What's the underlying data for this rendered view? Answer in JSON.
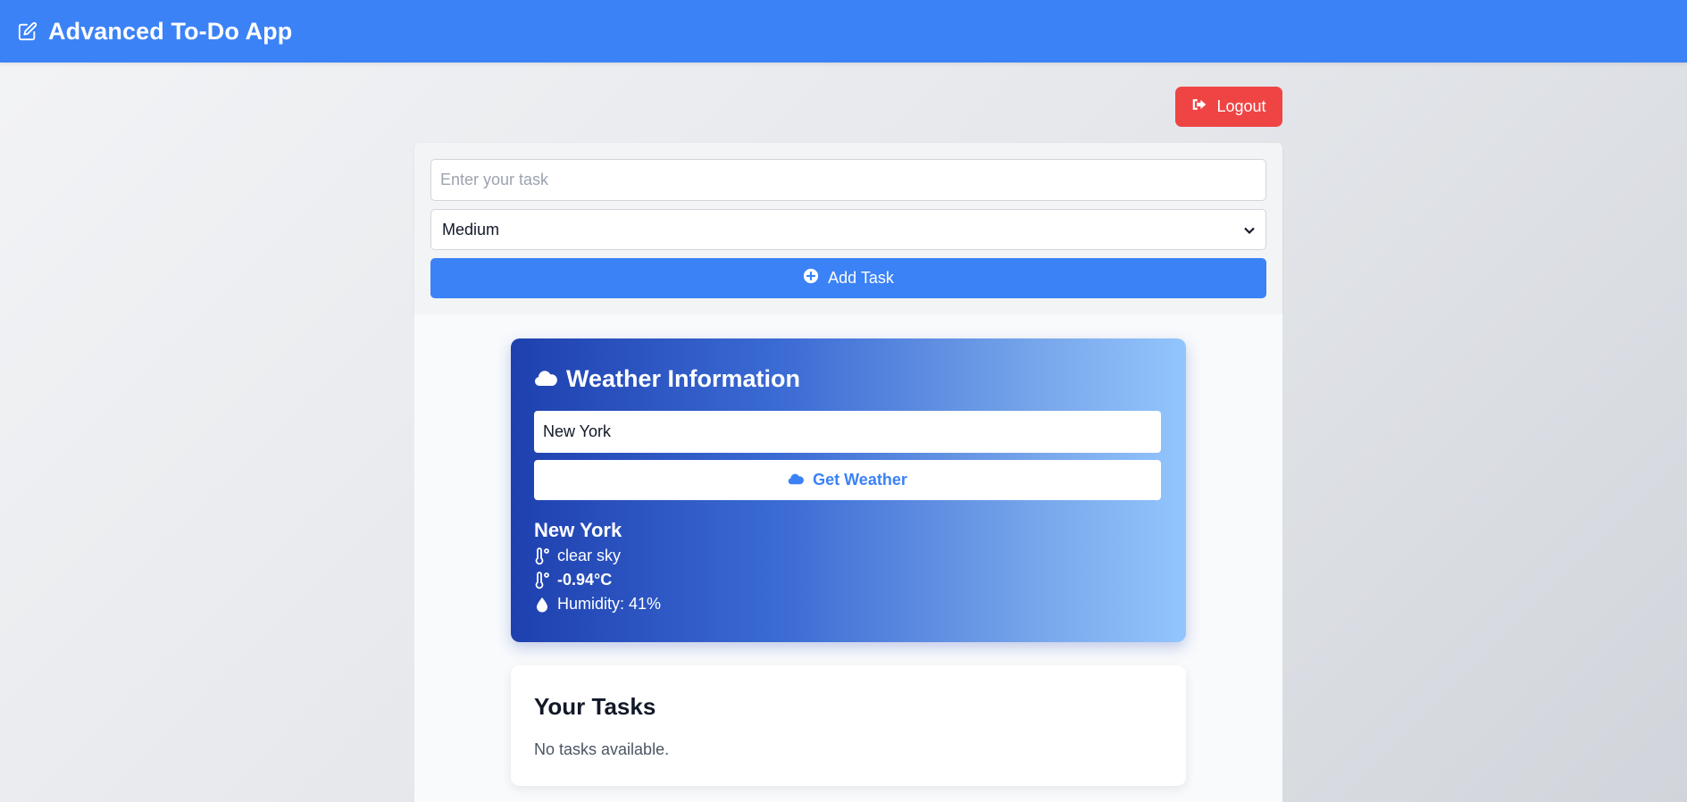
{
  "navbar": {
    "title": "Advanced To-Do App",
    "icon": "edit-icon",
    "bg_color": "#3b82f6"
  },
  "logout": {
    "label": "Logout",
    "icon": "sign-out-icon",
    "color": "#ef4444"
  },
  "task_form": {
    "input_placeholder": "Enter your task",
    "input_value": "",
    "priority_selected": "Medium",
    "add_label": "Add Task",
    "add_icon": "plus-circle-icon"
  },
  "weather": {
    "title": "Weather Information",
    "title_icon": "cloud-icon",
    "city_input_value": "New York",
    "button_label": "Get Weather",
    "button_icon": "cloud-icon",
    "result": {
      "city": "New York",
      "description": "clear sky",
      "temperature": "-0.94°C",
      "humidity": "Humidity: 41%"
    }
  },
  "tasks": {
    "title": "Your Tasks",
    "empty_text": "No tasks available."
  }
}
